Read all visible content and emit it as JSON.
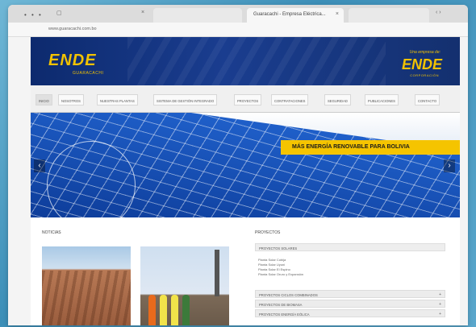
{
  "browser": {
    "window_controls": "• • •",
    "tabs": [
      {
        "label": "Guaracachi - Empresa Eléctrica..."
      }
    ],
    "url": "www.guaracachi.com.bo"
  },
  "header": {
    "logo_left": "ENDE",
    "logo_left_sub": "GUARACACHI",
    "logo_right_top": "Una empresa de:",
    "logo_right": "ENDE",
    "logo_right_sub": "CORPORACIÓN"
  },
  "nav": {
    "items": [
      {
        "label": "INICIO"
      },
      {
        "label": "NOSOTROS"
      },
      {
        "label": "NUESTRAS PLANTAS"
      },
      {
        "label": "SISTEMA DE GESTIÓN INTEGRADO"
      },
      {
        "label": "PROYECTOS"
      },
      {
        "label": "CONTRATACIONES"
      },
      {
        "label": "SEGURIDAD"
      },
      {
        "label": "PUBLICACIONES"
      },
      {
        "label": "CONTACTO"
      }
    ]
  },
  "banner": {
    "slogan": "MÁS ENERGÍA RENOVABLE PARA BOLIVIA",
    "prev_icon": "‹",
    "next_icon": "›"
  },
  "content": {
    "news_title": "NOTICIAS",
    "projects_title": "PROYECTOS",
    "projects_header": "PROYECTOS SOLARES",
    "project_lines": [
      "Planta Solar Cobija",
      "Planta Solar Uyuni",
      "Planta Solar El Espino",
      "Planta Solar Oruro y Expansión"
    ],
    "accordions": [
      {
        "label": "PROYECTOS CICLOS COMBINADOS",
        "icon": "+"
      },
      {
        "label": "PROYECTOS DE BIOMASA",
        "icon": "+"
      },
      {
        "label": "PROYECTOS ENERGÍA EÓLICA",
        "icon": "+"
      }
    ]
  },
  "colors": {
    "brand_blue": "#0d2a6e",
    "brand_yellow": "#f2c200"
  }
}
